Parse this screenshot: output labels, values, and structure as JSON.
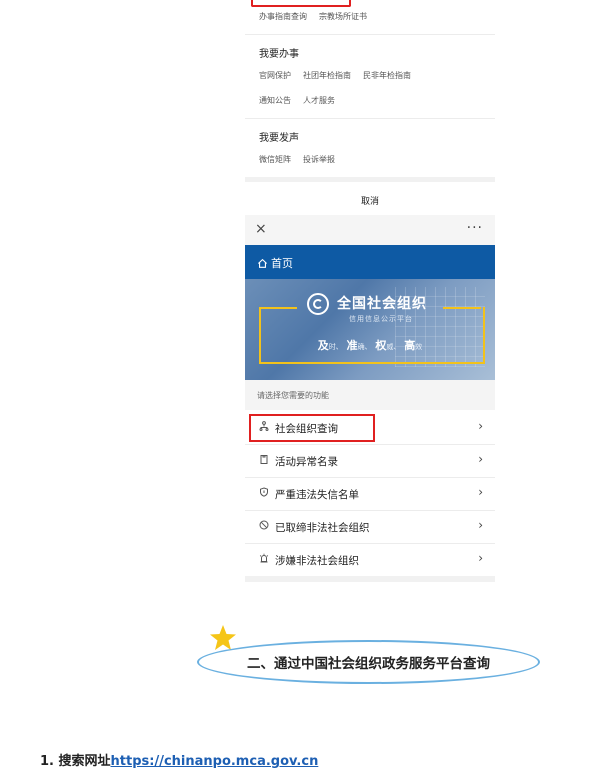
{
  "top_menu": {
    "row1": [
      "办事指南查询",
      "宗教场所证书"
    ],
    "section2_title": "我要办事",
    "section2_row1": [
      "官网保护",
      "社团年检指南",
      "民非年检指南"
    ],
    "section2_row2": [
      "通知公告",
      "人才服务"
    ],
    "section3_title": "我要发声",
    "section3_row1": [
      "微信矩阵",
      "投诉举报"
    ],
    "cancel": "取消"
  },
  "mini_program": {
    "close": "×",
    "more": "···",
    "home_label": "首页",
    "banner": {
      "title": "全国社会组织",
      "subtitle": "信用信息公示平台",
      "slogan": [
        {
          "big": "及",
          "small": "时、"
        },
        {
          "big": "准",
          "small": "确、"
        },
        {
          "big": "权",
          "small": "威、"
        },
        {
          "big": "高",
          "small": "效"
        }
      ]
    },
    "prompt": "请选择您需要的功能",
    "items": [
      {
        "label": "社会组织查询",
        "icon": "org-tree-icon"
      },
      {
        "label": "活动异常名录",
        "icon": "clipboard-icon"
      },
      {
        "label": "严重违法失信名单",
        "icon": "shield-icon"
      },
      {
        "label": "已取缔非法社会组织",
        "icon": "ban-icon"
      },
      {
        "label": "涉嫌非法社会组织",
        "icon": "alarm-icon"
      }
    ]
  },
  "heading": {
    "text": "二、通过中国社会组织政务服务平台查询",
    "accent_color": "#6ab0e0",
    "star_color": "#f5c518"
  },
  "step1": {
    "prefix": "1. 搜索网址",
    "url": "https://chinanpo.mca.gov.cn"
  },
  "colors": {
    "brand_blue": "#0e5aa4",
    "highlight_red": "#e02020"
  }
}
